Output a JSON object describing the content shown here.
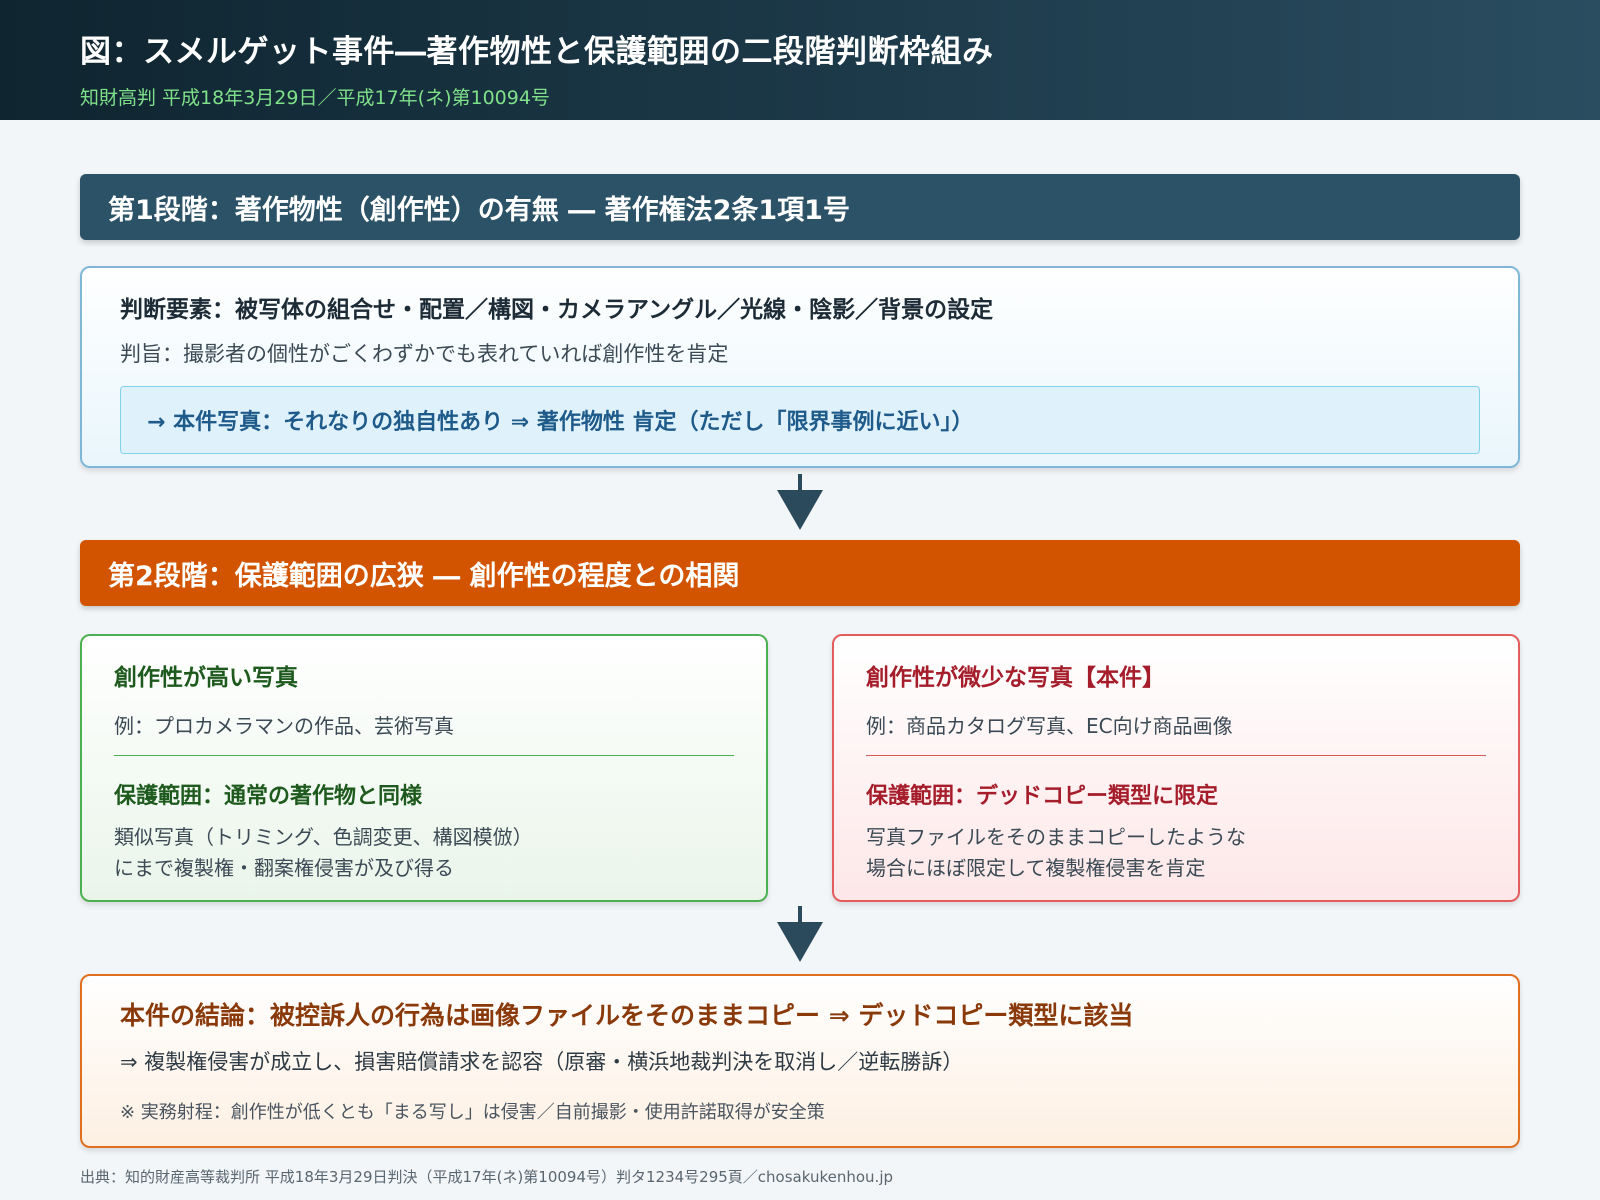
{
  "header": {
    "title": "図：スメルゲット事件―著作物性と保護範囲の二段階判断枠組み",
    "subtitle": "知財高判 平成18年3月29日／平成17年(ネ)第10094号"
  },
  "stage1": {
    "bar": "第1段階：著作物性（創作性）の有無 ― 著作権法2条1項1号",
    "title": "判断要素：被写体の組合せ・配置／構図・カメラアングル／光線・陰影／背景の設定",
    "note": "判旨：撮影者の個性がごくわずかでも表れていれば創作性を肯定",
    "result": "→ 本件写真：それなりの独自性あり ⇒ 著作物性 肯定（ただし「限界事例に近い」）"
  },
  "stage2": {
    "bar": "第2段階：保護範囲の広狭 ― 創作性の程度との相関",
    "high": {
      "title": "創作性が高い写真",
      "example": "例：プロカメラマンの作品、芸術写真",
      "scope_title": "保護範囲：通常の著作物と同様",
      "scope_line1": "類似写真（トリミング、色調変更、構図模倣）",
      "scope_line2": "にまで複製権・翻案権侵害が及び得る"
    },
    "low": {
      "title": "創作性が微少な写真【本件】",
      "example": "例：商品カタログ写真、EC向け商品画像",
      "scope_title": "保護範囲：デッドコピー類型に限定",
      "scope_line1": "写真ファイルをそのままコピーしたような",
      "scope_line2": "場合にほぼ限定して複製権侵害を肯定"
    }
  },
  "conclusion": {
    "title": "本件の結論：被控訴人の行為は画像ファイルをそのままコピー ⇒ デッドコピー類型に該当",
    "sub": "⇒ 複製権侵害が成立し、損害賠償請求を認容（原審・横浜地裁判決を取消し／逆転勝訴）",
    "note": "※ 実務射程：創作性が低くとも「まる写し」は侵害／自前撮影・使用許諾取得が安全策"
  },
  "footer": "出典：知的財産高等裁判所 平成18年3月29日判決（平成17年(ネ)第10094号）判タ1234号295頁／chosakukenhou.jp"
}
